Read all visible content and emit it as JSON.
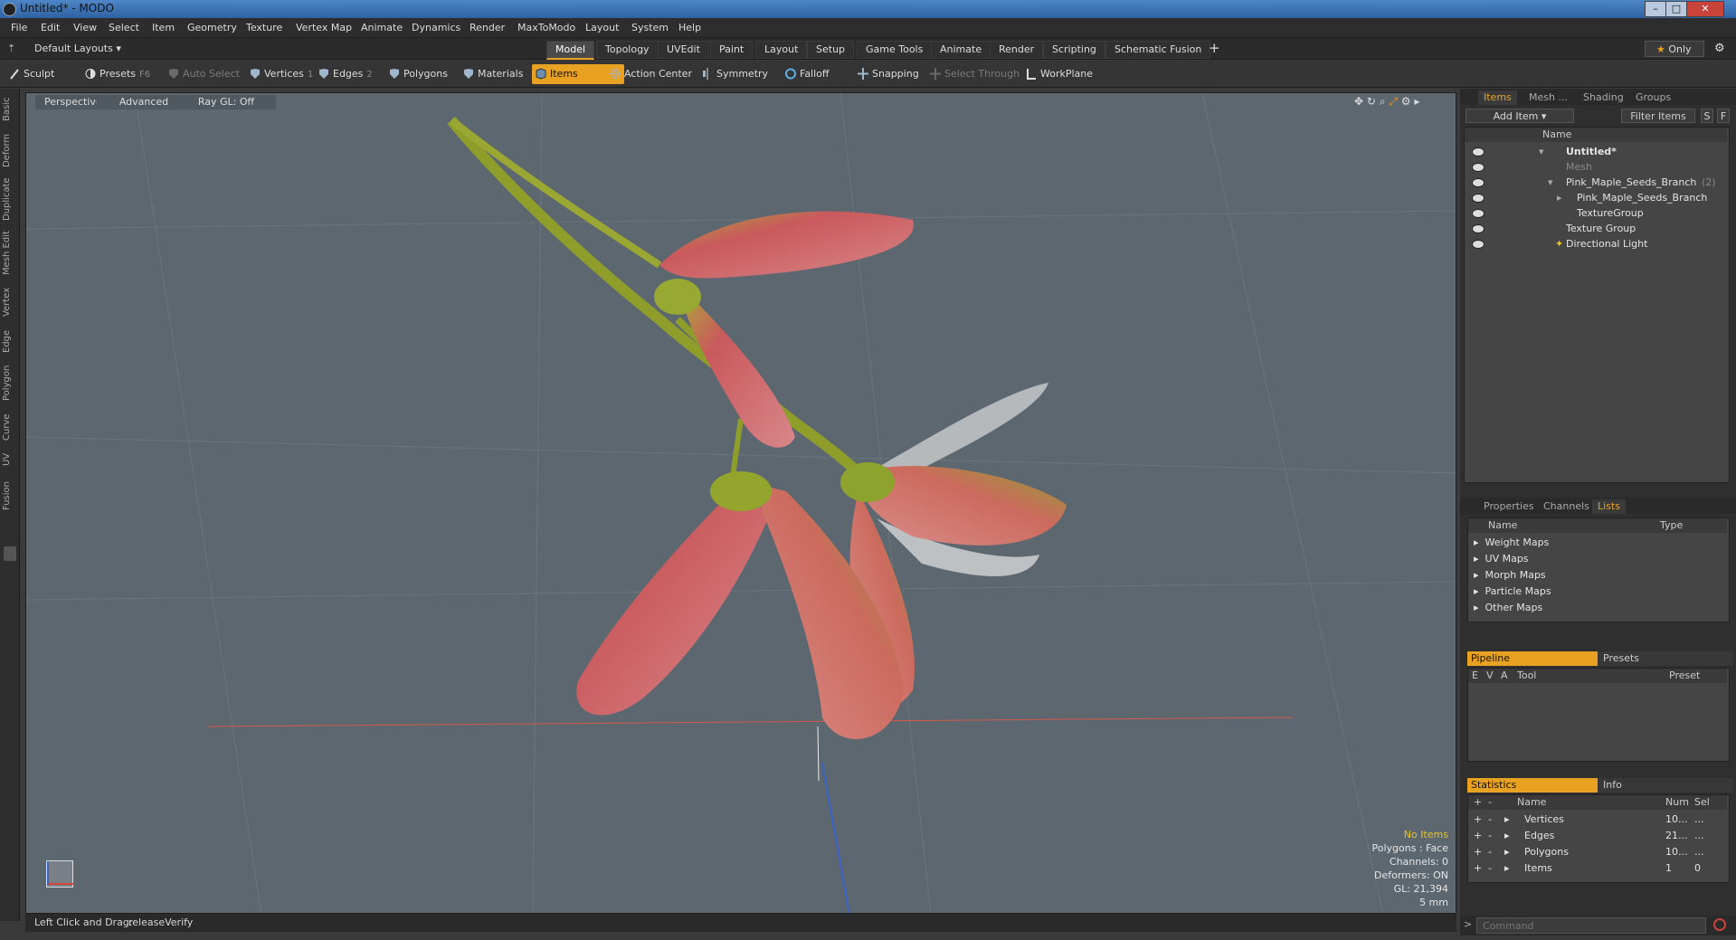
{
  "window": {
    "title": "Untitled* - MODO"
  },
  "menu": [
    "File",
    "Edit",
    "View",
    "Select",
    "Item",
    "Geometry",
    "Texture",
    "Vertex Map",
    "Animate",
    "Dynamics",
    "Render",
    "MaxToModo",
    "Layout",
    "System",
    "Help"
  ],
  "layout": {
    "default_layouts": "Default Layouts",
    "tabs": [
      "Model",
      "Topology",
      "UVEdit",
      "Paint",
      "Layout",
      "Setup",
      "Game Tools",
      "Animate",
      "Render",
      "Scripting",
      "Schematic Fusion"
    ],
    "active_tab": "Model",
    "only_label": "Only"
  },
  "toolbar": {
    "sculpt": "Sculpt",
    "presets": "Presets",
    "presets_key": "F6",
    "auto_select": "Auto Select",
    "vertices": "Vertices",
    "vertices_key": "1",
    "edges": "Edges",
    "edges_key": "2",
    "polygons": "Polygons",
    "materials": "Materials",
    "items": "Items",
    "action_center": "Action Center",
    "symmetry": "Symmetry",
    "falloff": "Falloff",
    "snapping": "Snapping",
    "select_through": "Select Through",
    "workplane": "WorkPlane"
  },
  "left_tabs": [
    "Basic",
    "Deform",
    "Duplicate",
    "Mesh Edit",
    "Vertex",
    "Edge",
    "Polygon",
    "Curve",
    "UV",
    "Fusion"
  ],
  "viewport": {
    "view": "Perspective",
    "advanced": "Advanced",
    "raygl": "Ray GL: Off",
    "info": {
      "items": "No Items",
      "polygons": "Polygons : Face",
      "channels": "Channels: 0",
      "deformers": "Deformers: ON",
      "gl": "GL: 21,394",
      "scale": "5 mm"
    }
  },
  "status": {
    "hint": "Left Click and Drag:",
    "action": "releaseVerify"
  },
  "items_panel": {
    "tabs": [
      "Items",
      "Mesh ...",
      "Shading",
      "Groups"
    ],
    "add_item": "Add Item",
    "filter": "Filter Items",
    "s": "S",
    "f": "F",
    "col_name": "Name",
    "tree": [
      {
        "label": "Untitled*",
        "extra": ""
      },
      {
        "label": "Mesh",
        "extra": ""
      },
      {
        "label": "Pink_Maple_Seeds_Branch",
        "extra": "(2)"
      },
      {
        "label": "Pink_Maple_Seeds_Branch",
        "extra": ""
      },
      {
        "label": "TextureGroup",
        "extra": ""
      },
      {
        "label": "Texture Group",
        "extra": ""
      },
      {
        "label": "Directional Light",
        "extra": ""
      }
    ]
  },
  "lists_panel": {
    "tabs": [
      "Properties",
      "Channels",
      "Lists"
    ],
    "col_name": "Name",
    "col_type": "Type",
    "rows": [
      "Weight Maps",
      "UV Maps",
      "Morph Maps",
      "Particle Maps",
      "Other Maps"
    ]
  },
  "pipeline": {
    "tab": "Pipeline",
    "presets": "Presets",
    "cols": {
      "e": "E",
      "v": "V",
      "a": "A",
      "tool": "Tool",
      "preset": "Preset"
    }
  },
  "statistics": {
    "tab": "Statistics",
    "info": "Info",
    "cols": {
      "name": "Name",
      "num": "Num",
      "sel": "Sel"
    },
    "rows": [
      {
        "name": "Vertices",
        "num": "10...",
        "sel": "..."
      },
      {
        "name": "Edges",
        "num": "21...",
        "sel": "..."
      },
      {
        "name": "Polygons",
        "num": "10...",
        "sel": "..."
      },
      {
        "name": "Items",
        "num": "1",
        "sel": "0"
      }
    ]
  },
  "command": {
    "placeholder": "Command"
  },
  "colors": {
    "accent": "#e8a120",
    "viewport_bg": "#5d6770",
    "leaf_red": "#c9595c",
    "leaf_green": "#7f9a2a"
  }
}
